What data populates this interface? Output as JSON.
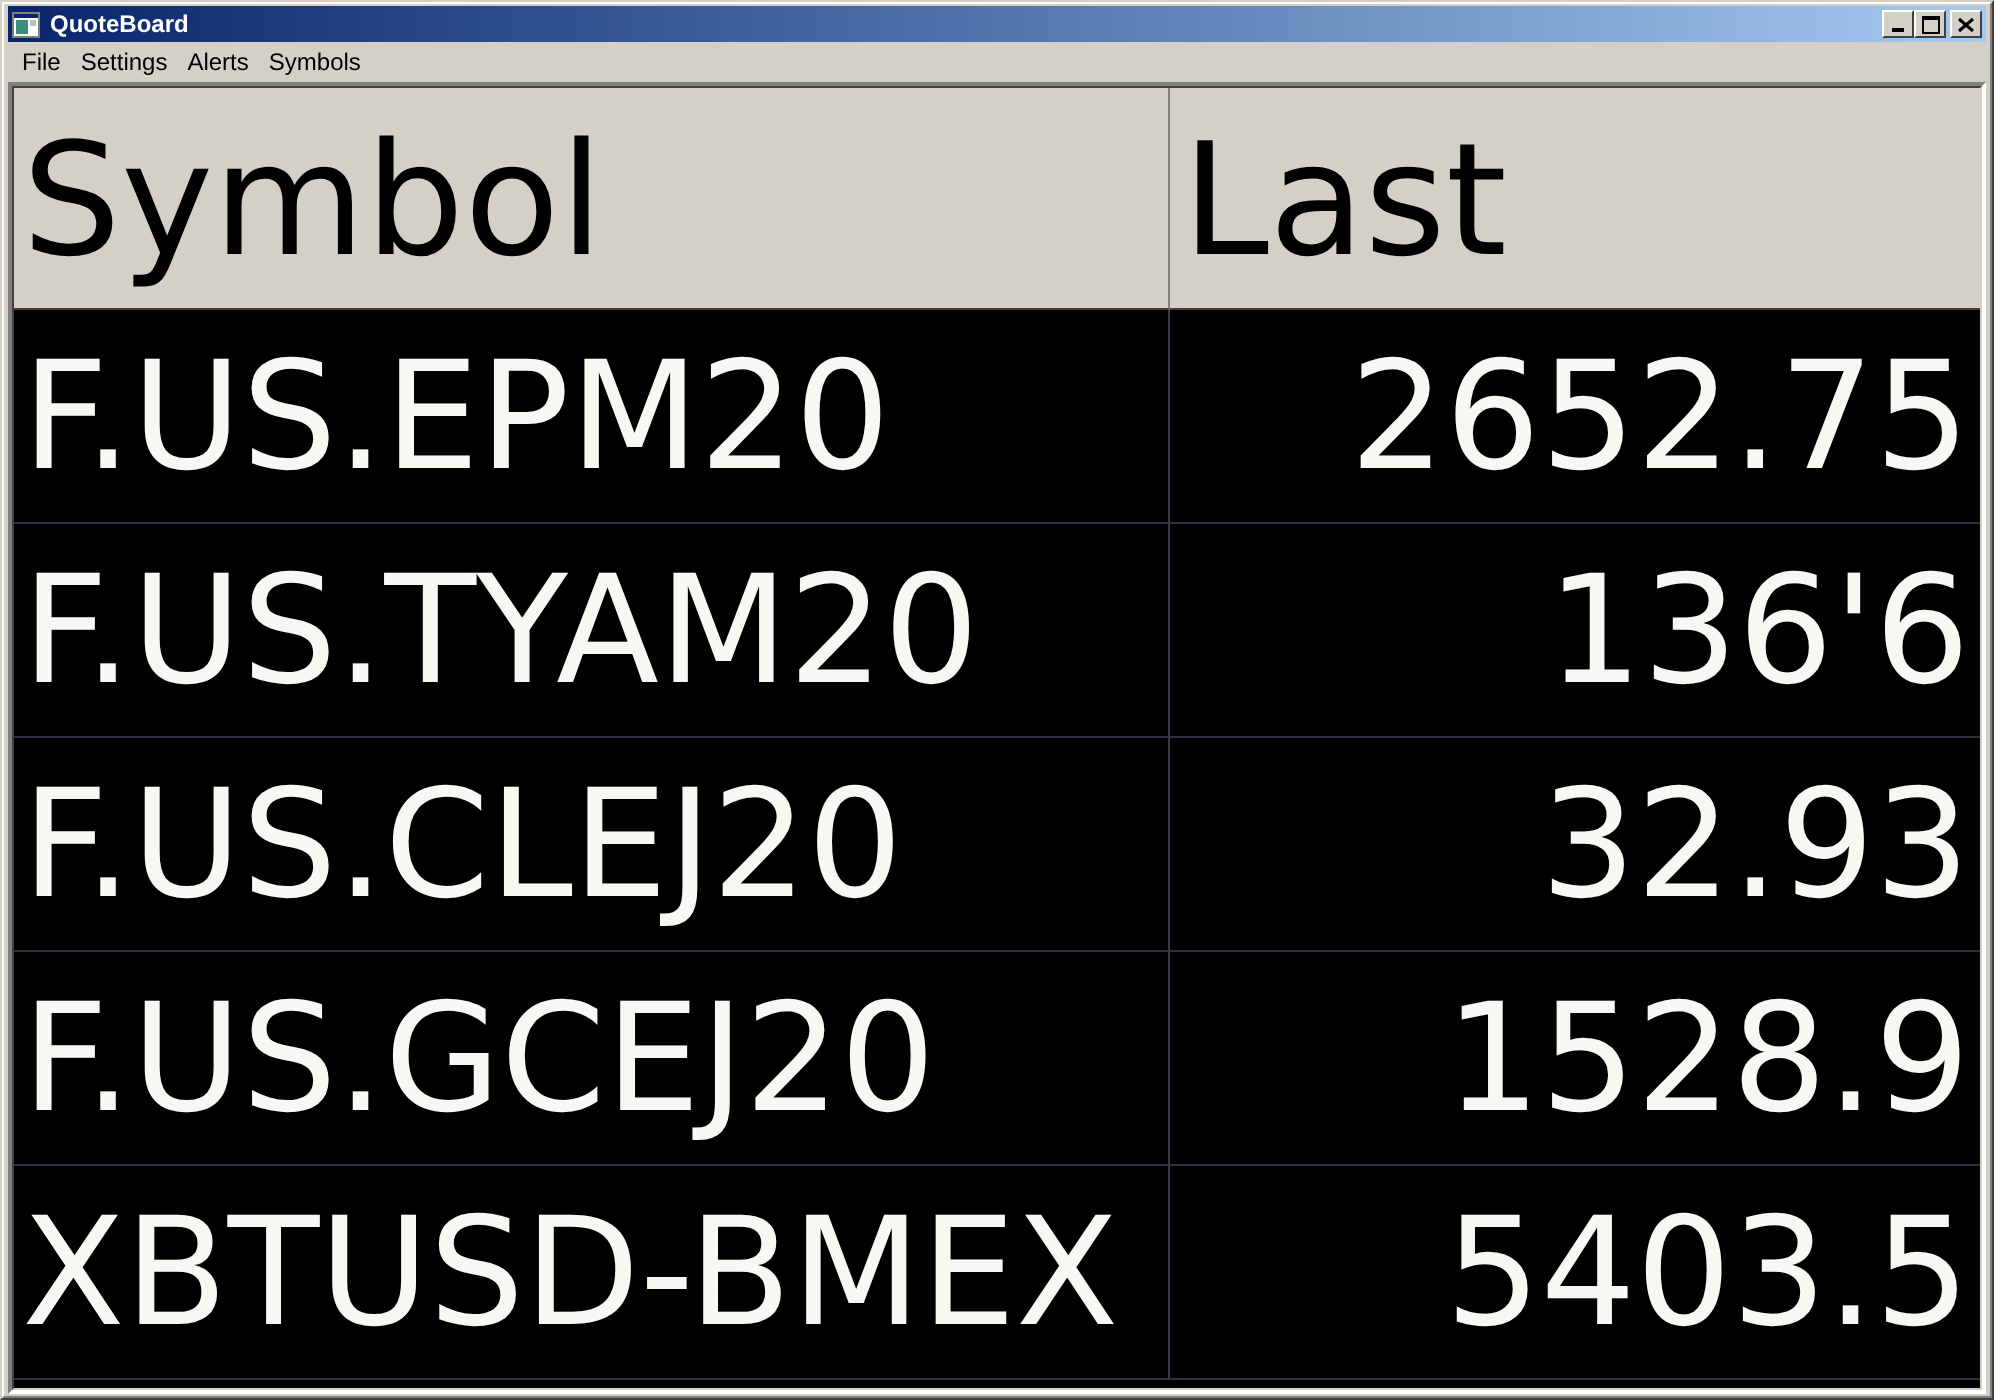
{
  "window": {
    "title": "QuoteBoard"
  },
  "menu": [
    "File",
    "Settings",
    "Alerts",
    "Symbols"
  ],
  "table": {
    "columns": [
      "Symbol",
      "Last"
    ],
    "rows": [
      [
        "F.US.EPM20",
        "2652.75"
      ],
      [
        "F.US.TYAM20",
        "136'6"
      ],
      [
        "F.US.CLEJ20",
        "32.93"
      ],
      [
        "F.US.GCEJ20",
        "1528.9"
      ],
      [
        "XBTUSD-BMEX",
        "5403.5"
      ]
    ]
  }
}
